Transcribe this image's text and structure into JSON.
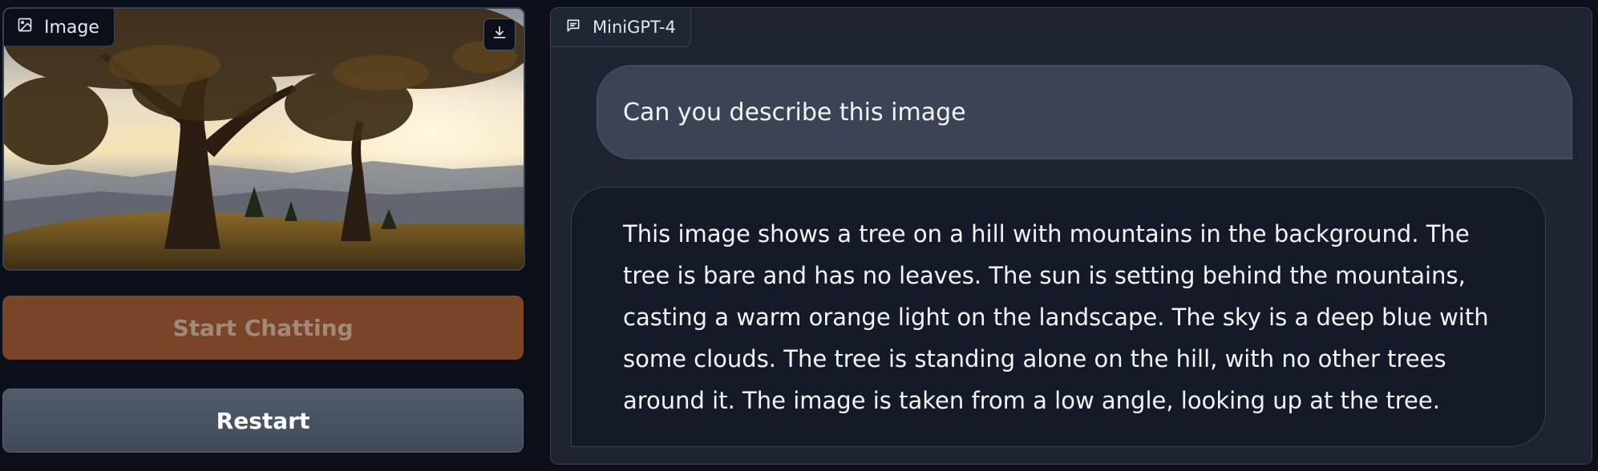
{
  "image_panel": {
    "label": "Image",
    "label_icon": "image-icon",
    "download_icon": "download-icon"
  },
  "buttons": {
    "start": "Start Chatting",
    "restart": "Restart"
  },
  "chat": {
    "label": "MiniGPT-4",
    "label_icon": "chat-icon",
    "messages": [
      {
        "role": "user",
        "text": "Can you describe this image"
      },
      {
        "role": "bot",
        "text": "This image shows a tree on a hill with mountains in the background. The tree is bare and has no leaves. The sun is setting behind the mountains, casting a warm orange light on the landscape. The sky is a deep blue with some clouds. The tree is standing alone on the hill, with no other trees around it. The image is taken from a low angle, looking up at the tree."
      }
    ]
  },
  "colors": {
    "background": "#0b0f19",
    "start_button": "#7a4527",
    "restart_button": "#4a5563",
    "user_bubble": "#3b4454",
    "bot_bubble": "#151a28"
  }
}
